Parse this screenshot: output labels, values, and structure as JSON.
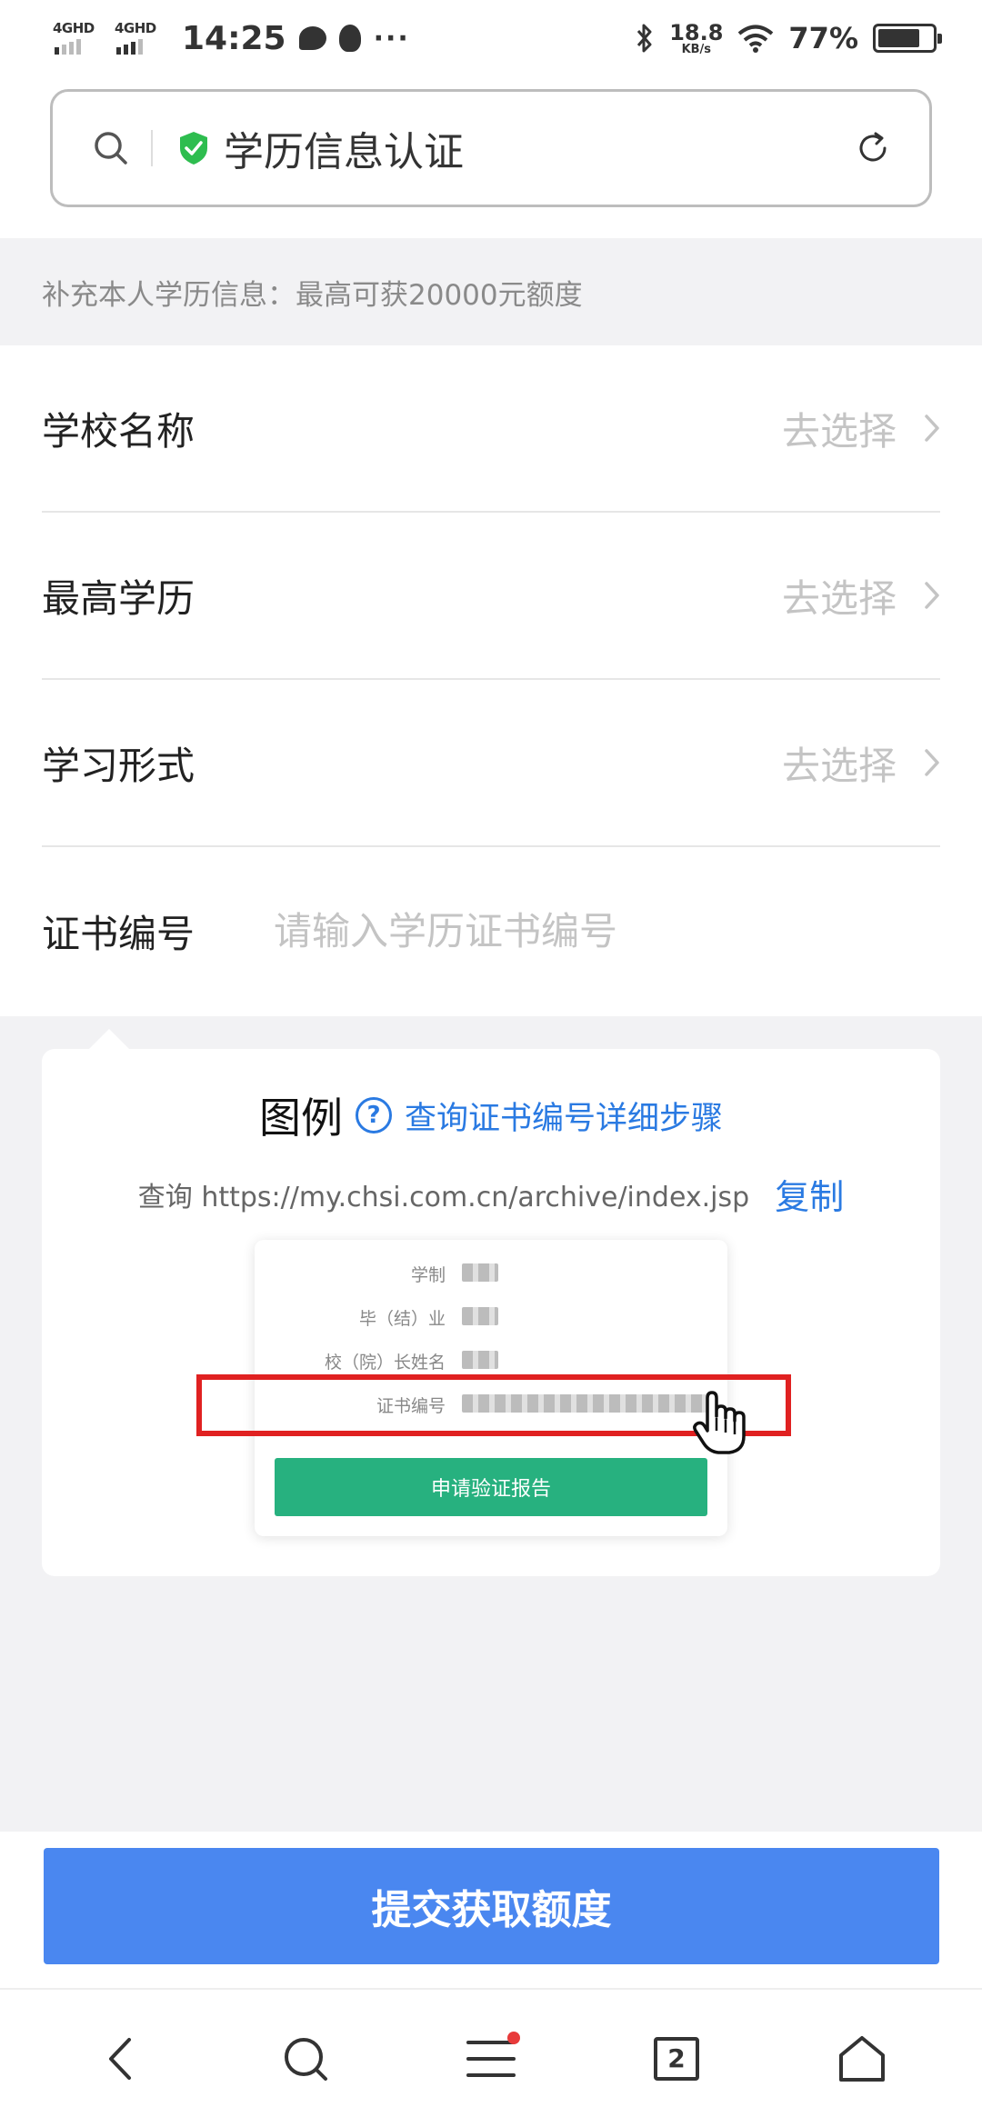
{
  "status_bar": {
    "sim1_label": "4GHD",
    "sim2_label": "4GHD",
    "time": "14:25",
    "net_speed_value": "18.8",
    "net_speed_unit": "KB/s",
    "battery_percent": "77%",
    "battery_level": 0.77,
    "icons": [
      "signal-icon",
      "chat-bubble-icon",
      "qq-penguin-icon",
      "more-dots-icon",
      "bluetooth-icon",
      "wifi-icon",
      "battery-icon"
    ]
  },
  "browser": {
    "page_title": "学历信息认证",
    "icons": [
      "search-icon",
      "shield-check-icon",
      "reload-icon"
    ],
    "accent_color": "#2ebd4f"
  },
  "banner": {
    "text": "补充本人学历信息：最高可获20000元额度"
  },
  "form": {
    "rows": [
      {
        "label": "学校名称",
        "action": "去选择"
      },
      {
        "label": "最高学历",
        "action": "去选择"
      },
      {
        "label": "学习形式",
        "action": "去选择"
      }
    ],
    "certificate": {
      "label": "证书编号",
      "placeholder": "请输入学历证书编号"
    }
  },
  "example": {
    "title": "图例",
    "help_icon": "?",
    "help_link": "查询证书编号详细步骤",
    "query_text": "查询 https://my.chsi.com.cn/archive/index.jsp",
    "copy_label": "复制",
    "screenshot": {
      "rows": [
        "学制",
        "毕（结）业",
        "校（院）长姓名",
        "证书编号"
      ],
      "button": "申请验证报告"
    }
  },
  "submit": {
    "label": "提交获取额度",
    "color": "#4a87f0"
  },
  "bottom_nav": {
    "items": [
      "back-icon",
      "search-icon",
      "menu-icon",
      "tabs-icon",
      "home-icon"
    ],
    "tab_count": "2"
  }
}
